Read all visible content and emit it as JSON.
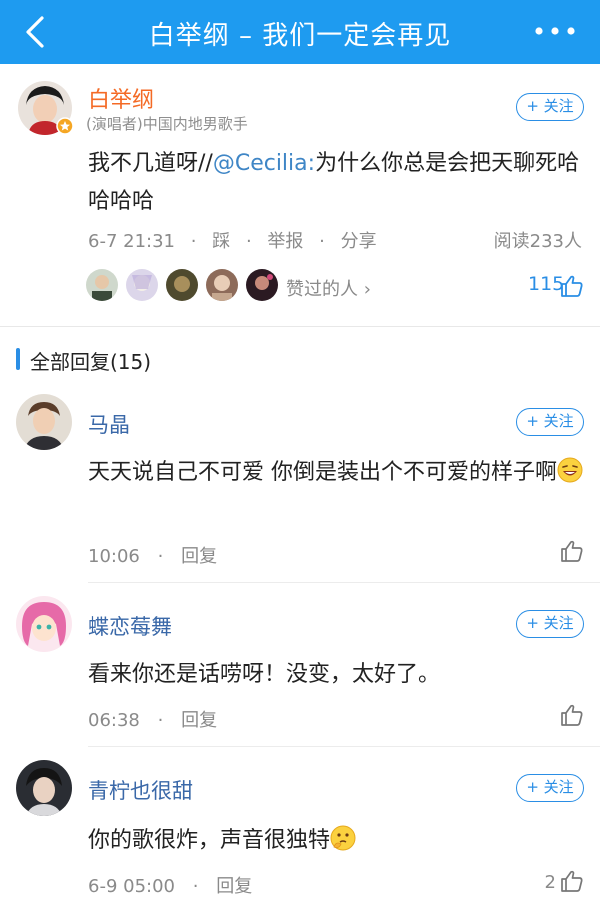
{
  "header": {
    "title": "白举纲 – 我们一定会再见",
    "back_icon": "chevron-left-icon",
    "more_icon": "more-dots-icon",
    "bg_color": "#1e9bf0"
  },
  "post": {
    "author": "白举纲",
    "author_desc": "(演唱者)中国内地男歌手",
    "follow_label": "+ 关注",
    "text_before": "我不几道呀//",
    "mention": "@Cecilia:",
    "text_after": "为什么你总是会把天聊死哈哈哈哈",
    "time": "6-7 21:31",
    "dislike": "踩",
    "report": "举报",
    "share": "分享",
    "dot": "·",
    "reads": "阅读233人",
    "likers_label": "赞过的人 ›",
    "like_count": "115"
  },
  "section": {
    "label": "全部回复(15)"
  },
  "replies": [
    {
      "name": "马晶",
      "follow_label": "+ 关注",
      "text": "天天说自己不可爱 你倒是装出个不可爱的样子啊",
      "emoji": "laughing-emoji",
      "time": "10:06",
      "reply_label": "回复",
      "likes": ""
    },
    {
      "name": "蝶恋莓舞",
      "follow_label": "+ 关注",
      "text": "看来你还是话唠呀！没变，太好了。",
      "time": "06:38",
      "reply_label": "回复",
      "likes": ""
    },
    {
      "name": "青柠也很甜",
      "follow_label": "+ 关注",
      "text": "你的歌很炸，声音很独特",
      "emoji": "thinking-emoji",
      "time": "6-9 05:00",
      "reply_label": "回复",
      "likes": "2"
    }
  ],
  "colors": {
    "accent": "#2a8ee5",
    "author_name": "#f46a25",
    "reply_name": "#3a68a8",
    "meta": "#8a8a8a"
  }
}
